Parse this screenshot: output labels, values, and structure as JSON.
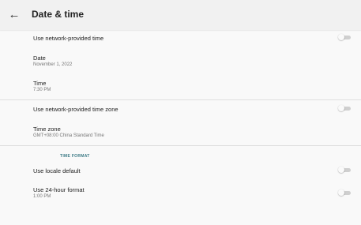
{
  "header": {
    "title": "Date & time"
  },
  "settings": {
    "network_time": {
      "label": "Use network-provided time",
      "enabled": false
    },
    "date": {
      "label": "Date",
      "value": "November 1, 2022"
    },
    "time": {
      "label": "Time",
      "value": "7:30 PM"
    },
    "network_timezone": {
      "label": "Use network-provided time zone",
      "enabled": false
    },
    "timezone": {
      "label": "Time zone",
      "value": "GMT+08:00 China Standard Time"
    }
  },
  "time_format": {
    "header": "TIME FORMAT",
    "locale_default": {
      "label": "Use locale default",
      "enabled": false
    },
    "use_24_hour": {
      "label": "Use 24-hour format",
      "value": "1:00 PM",
      "enabled": false
    }
  }
}
